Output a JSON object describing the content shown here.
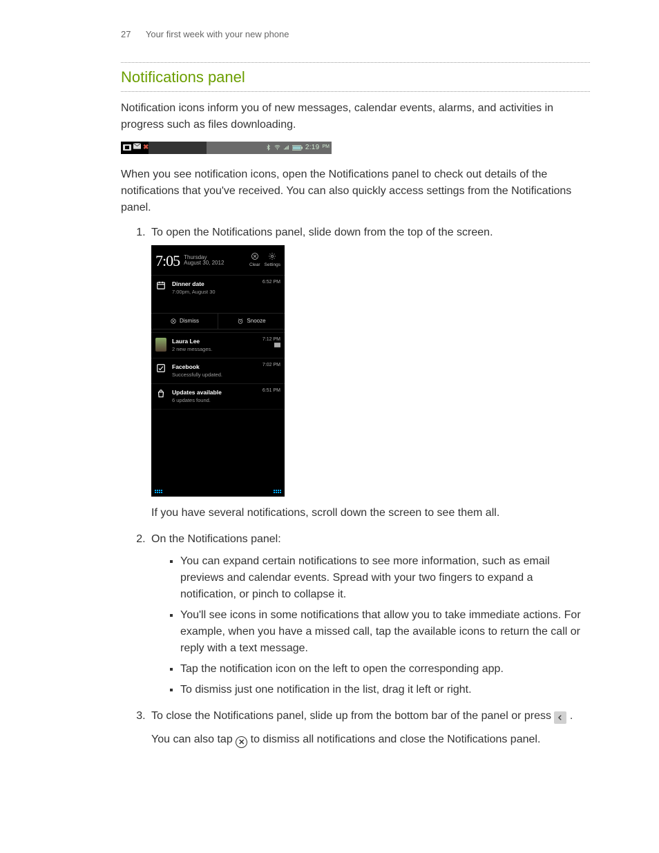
{
  "header": {
    "page_number": "27",
    "chapter": "Your first week with your new phone"
  },
  "section_title": "Notifications panel",
  "intro_para": "Notification icons inform you of new messages, calendar events, alarms, and activities in progress such as files downloading.",
  "statusbar": {
    "time": "2:19",
    "pm": "PM"
  },
  "after_statusbar": "When you see notification icons, open the Notifications panel to check out details of the notifications that you've received. You can also quickly access settings from the Notifications panel.",
  "steps": {
    "s1": "To open the Notifications panel, slide down from the top of the screen.",
    "s1_after": "If you have several notifications, scroll down the screen to see them all.",
    "s2": "On the Notifications panel:",
    "s2_bullets": {
      "b1": "You can expand certain notifications to see more information, such as email previews and calendar events. Spread with your two fingers to expand a notification, or pinch to collapse it.",
      "b2": "You'll see icons in some notifications that allow you to take immediate actions. For example, when you have a missed call, tap the available icons to return the call or reply with a text message.",
      "b3": "Tap the notification icon on the left to open the corresponding app.",
      "b4": "To dismiss just one notification in the list, drag it left or right."
    },
    "s3_a": "To close the Notifications panel, slide up from the bottom bar of the panel or press ",
    "s3_b": ".",
    "s3_after_a": "You can also tap ",
    "s3_after_b": " to dismiss all notifications and close the Notifications panel."
  },
  "phone": {
    "header": {
      "time": "7:05",
      "day": "Thursday",
      "date": "August 30, 2012",
      "clear_label": "Clear",
      "settings_label": "Settings"
    },
    "actions": {
      "dismiss": "Dismiss",
      "snooze": "Snooze"
    },
    "n1": {
      "title": "Dinner date",
      "sub": "7:00pm, August 30",
      "time": "6:52 PM"
    },
    "n2": {
      "title": "Laura Lee",
      "sub": "2 new messages.",
      "time": "7:12 PM"
    },
    "n3": {
      "title": "Facebook",
      "sub": "Successfully updated.",
      "time": "7:02 PM"
    },
    "n4": {
      "title": "Updates available",
      "sub": "6 updates found.",
      "time": "6:51 PM"
    }
  }
}
